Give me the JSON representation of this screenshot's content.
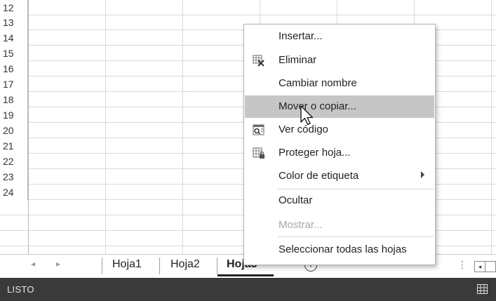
{
  "grid": {
    "row_numbers": [
      "12",
      "13",
      "14",
      "15",
      "16",
      "17",
      "18",
      "19",
      "20",
      "21",
      "22",
      "23",
      "24"
    ]
  },
  "sheet_tabs": {
    "tabs": [
      "Hoja1",
      "Hoja2",
      "Hoja3"
    ],
    "active": "Hoja3",
    "prev_label": "◂",
    "next_label": "▸",
    "add_label": "+",
    "overflow_label": "⋮",
    "scroll_left_label": "◂"
  },
  "status_bar": {
    "status": "LISTO",
    "view_icon": "normal-view-icon"
  },
  "context_menu": {
    "items": [
      {
        "label": "Insertar...",
        "icon": ""
      },
      {
        "label": "Eliminar",
        "icon": "delete-sheet-icon"
      },
      {
        "label": "Cambiar nombre",
        "icon": ""
      },
      {
        "label": "Mover o copiar...",
        "icon": "",
        "hovered": true
      },
      {
        "label": "Ver código",
        "icon": "view-code-icon"
      },
      {
        "label": "Proteger hoja...",
        "icon": "protect-sheet-icon"
      },
      {
        "label": "Color de etiqueta",
        "icon": "",
        "submenu": true
      },
      {
        "label": "Ocultar",
        "icon": ""
      },
      {
        "label": "Mostrar...",
        "icon": "",
        "disabled": true
      },
      {
        "label": "Seleccionar todas las hojas",
        "icon": ""
      }
    ]
  },
  "colors": {
    "status_bar_bg": "#3a3a3a",
    "menu_hover_bg": "#c6c6c6",
    "disabled_text": "#a6a6a6"
  }
}
